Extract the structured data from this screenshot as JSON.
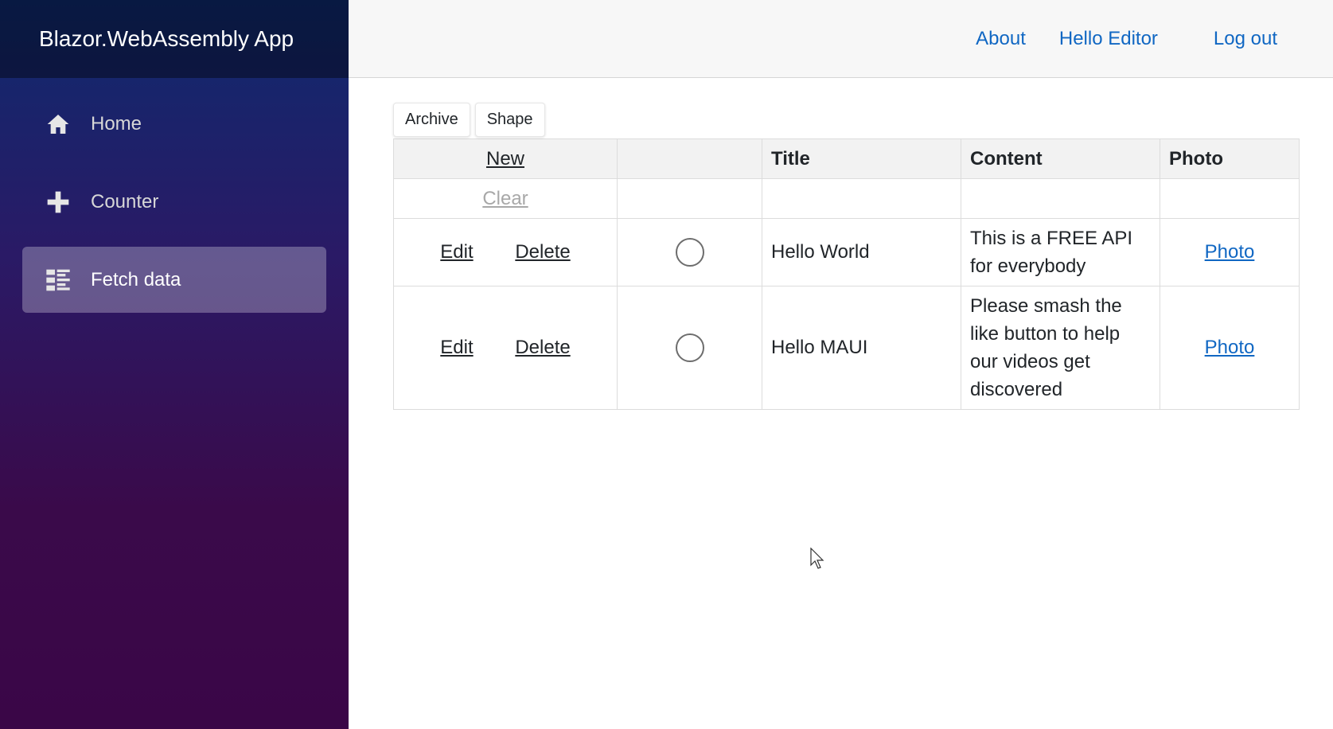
{
  "brand": "Blazor.WebAssembly App",
  "nav": {
    "items": [
      {
        "label": "Home",
        "icon": "home-icon"
      },
      {
        "label": "Counter",
        "icon": "plus-icon"
      },
      {
        "label": "Fetch data",
        "icon": "list-icon"
      }
    ],
    "active": "Fetch data"
  },
  "topbar": {
    "about": "About",
    "user": "Hello Editor",
    "logout": "Log out"
  },
  "toolbar": {
    "archive": "Archive",
    "shape": "Shape"
  },
  "grid": {
    "header": {
      "new_link": "New",
      "col_blank": "",
      "title": "Title",
      "content": "Content",
      "photo": "Photo"
    },
    "filter": {
      "clear": "Clear"
    },
    "rows": [
      {
        "edit": "Edit",
        "delete": "Delete",
        "title": "Hello World",
        "content": "This is a FREE API for everybody",
        "photo": "Photo"
      },
      {
        "edit": "Edit",
        "delete": "Delete",
        "title": "Hello MAUI",
        "content": "Please smash the like button to help our videos get discovered",
        "photo": "Photo"
      }
    ]
  },
  "colors": {
    "link": "#1067c3",
    "sidebar_top": "#0e2a6e",
    "sidebar_bottom": "#3a0647"
  }
}
